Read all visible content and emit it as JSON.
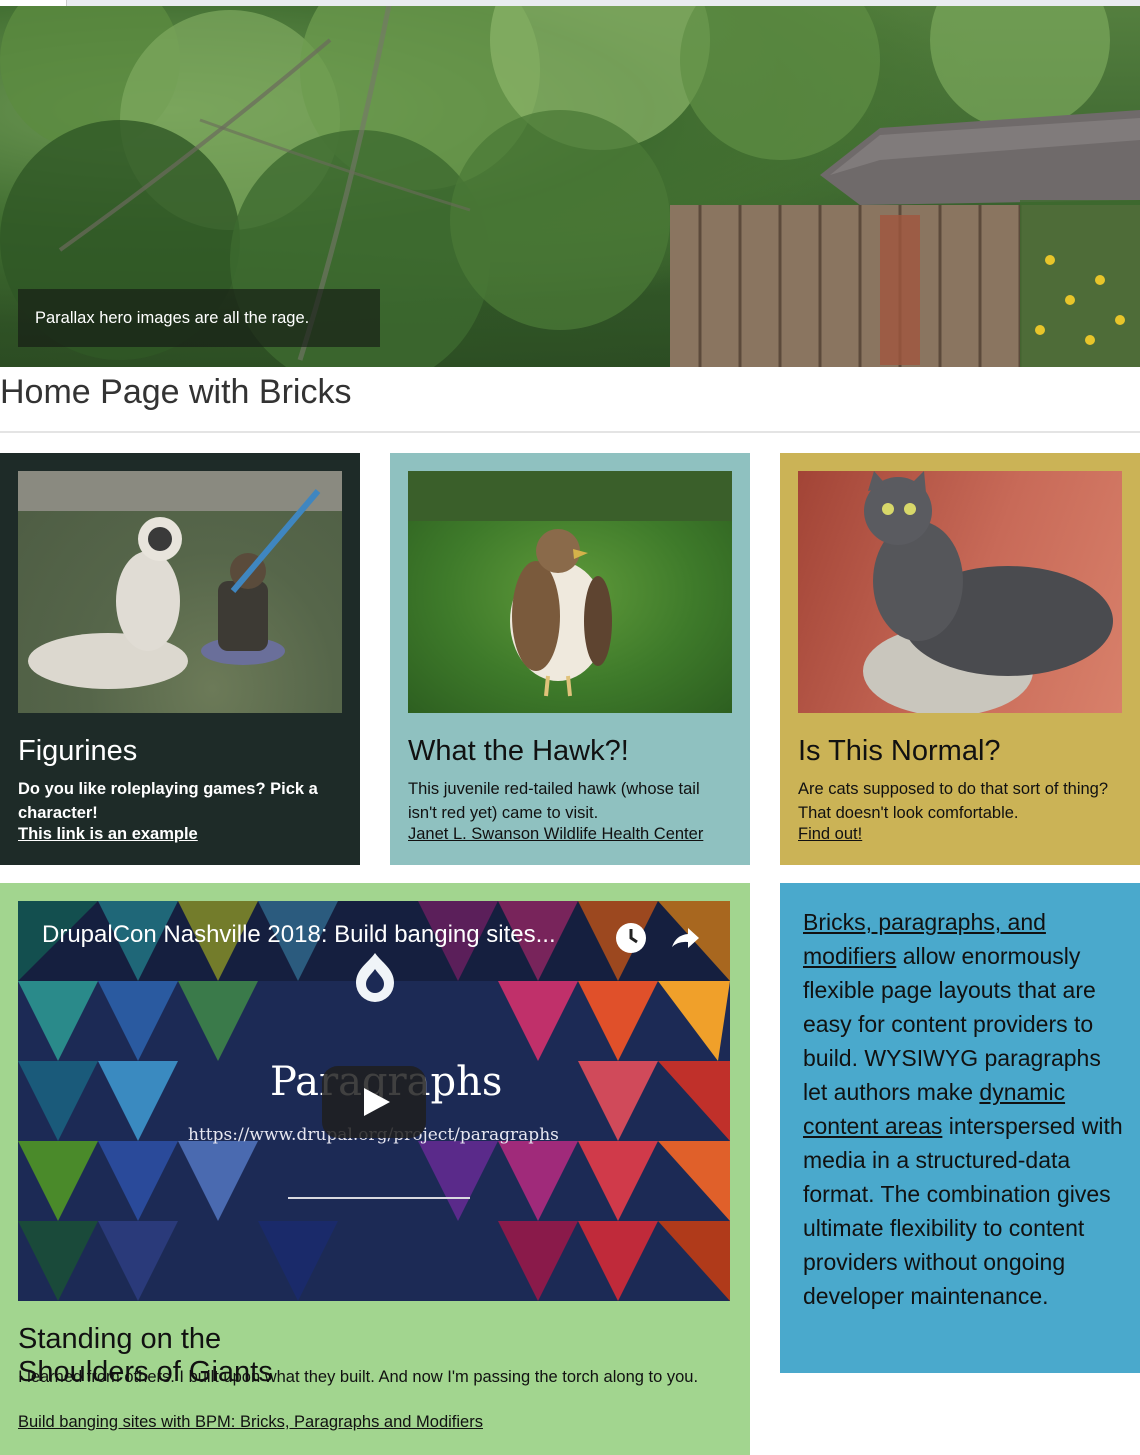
{
  "hero": {
    "caption": "Parallax hero images are all the rage."
  },
  "page": {
    "title": "Home Page with Bricks"
  },
  "cards": [
    {
      "title": "Figurines",
      "body": "Do you like roleplaying games? Pick a character!",
      "link": "This link is an example",
      "background": "#1e2b28"
    },
    {
      "title": "What the Hawk?!",
      "body": "This juvenile red-tailed hawk (whose tail isn't red yet) came to visit.",
      "link": "Janet L. Swanson Wildlife Health Center",
      "background": "#8fc1c0"
    },
    {
      "title": "Is This Normal?",
      "body": "Are cats supposed to do that sort of thing? That doesn't look comfortable.",
      "link": "Find out!",
      "background": "#cbb356"
    }
  ],
  "video_card": {
    "video_title": "DrupalCon Nashville 2018: Build banging sites...",
    "video_word": "Paragraphs",
    "video_url": "https://www.drupal.org/project/paragraphs",
    "title": "Standing on the Shoulders of Giants",
    "body": "I learned from others. I built upon what they built. And now I'm passing the torch along to you.",
    "link": "Build banging sites with BPM: Bricks, Paragraphs and Modifiers",
    "background": "#a2d58f"
  },
  "text_card": {
    "link1": "Bricks, paragraphs, and modifiers",
    "text1": " allow enormously flexible page layouts that are easy for content providers to build. WYSIWYG paragraphs let authors make ",
    "link2": "dynamic content areas",
    "text2": " interspersed with media in a structured-data format. The combination gives ultimate flexibility to content providers without ongoing developer maintenance.",
    "background": "#4aa9cc"
  }
}
